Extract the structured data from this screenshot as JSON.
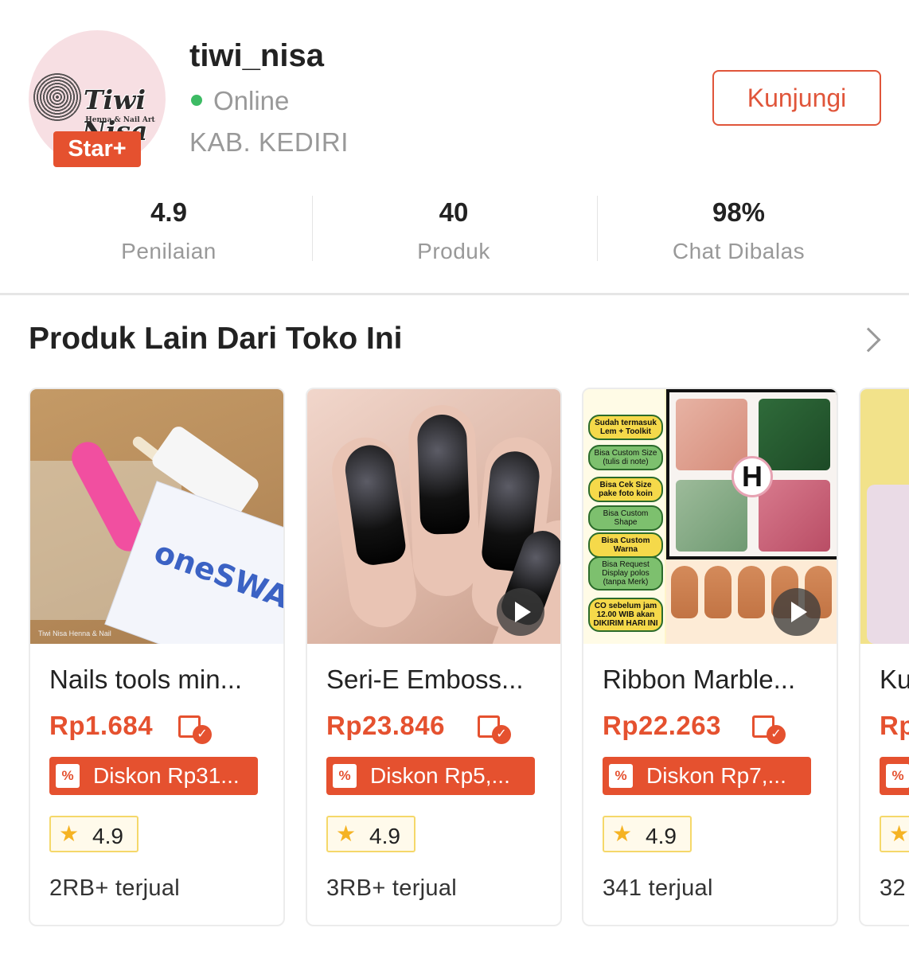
{
  "shop": {
    "logo_text": "Tiwi Nisa",
    "logo_subtext": "Henna & Nail Art",
    "badge": "Star+",
    "name": "tiwi_nisa",
    "status": "Online",
    "location": "KAB. KEDIRI",
    "visit_label": "Kunjungi",
    "status_color": "#3dbb64",
    "accent_color": "#e5512f"
  },
  "stats": [
    {
      "value": "4.9",
      "label": "Penilaian"
    },
    {
      "value": "40",
      "label": "Produk"
    },
    {
      "value": "98%",
      "label": "Chat Dibalas"
    }
  ],
  "section": {
    "title": "Produk Lain Dari Toko Ini",
    "more_icon": "chevron-right-icon"
  },
  "products": [
    {
      "name": "Nails tools min...",
      "price": "Rp1.684",
      "discount": "Diskon Rp31...",
      "rating": "4.9",
      "sold": "2RB+ terjual",
      "has_video": false,
      "watermark": "Tiwi Nisa Henna & Nail",
      "swab_text": "oneSWABS"
    },
    {
      "name": "Seri-E Emboss...",
      "price": "Rp23.846",
      "discount": "Diskon Rp5,...",
      "rating": "4.9",
      "sold": "3RB+ terjual",
      "has_video": true
    },
    {
      "name": "Ribbon Marble...",
      "price": "Rp22.263",
      "discount": "Diskon Rp7,...",
      "rating": "4.9",
      "sold": "341 terjual",
      "has_video": true,
      "thumb_labels": [
        "Sudah termasuk Lem + Toolkit",
        "Bisa Custom Size (tulis di note)",
        "Bisa Cek Size pake foto koin",
        "Bisa Custom Shape",
        "Bisa Custom Warna",
        "Bisa Request Display polos (tanpa Merk)",
        "CO sebelum jam 12.00 WIB akan DIKIRIM HARI INI"
      ],
      "thumb_badge": "H"
    },
    {
      "name": "Ku",
      "price": "Rp",
      "discount": "",
      "rating": "",
      "sold": "32",
      "has_video": false
    }
  ]
}
